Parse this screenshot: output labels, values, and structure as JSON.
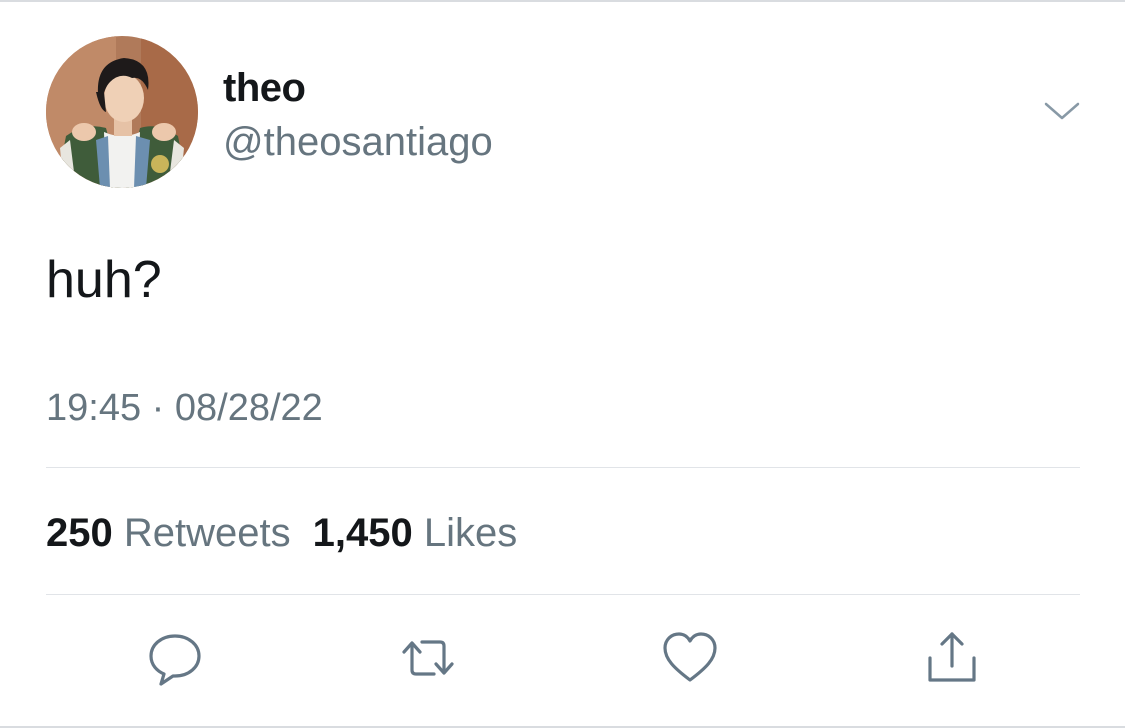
{
  "user": {
    "display_name": "theo",
    "handle": "@theosantiago"
  },
  "tweet": {
    "text": "huh?",
    "timestamp": "19:45 · 08/28/22"
  },
  "stats": {
    "retweets_count": "250",
    "retweets_label": "Retweets",
    "likes_count": "1,450",
    "likes_label": "Likes"
  },
  "actions": [
    {
      "name": "reply",
      "icon": "reply-icon"
    },
    {
      "name": "retweet",
      "icon": "retweet-icon"
    },
    {
      "name": "like",
      "icon": "heart-icon"
    },
    {
      "name": "share",
      "icon": "share-icon"
    }
  ],
  "colors": {
    "primary_text": "#14171a",
    "secondary_text": "#66757f",
    "divider": "#e1e4e8",
    "icon": "#657786"
  }
}
